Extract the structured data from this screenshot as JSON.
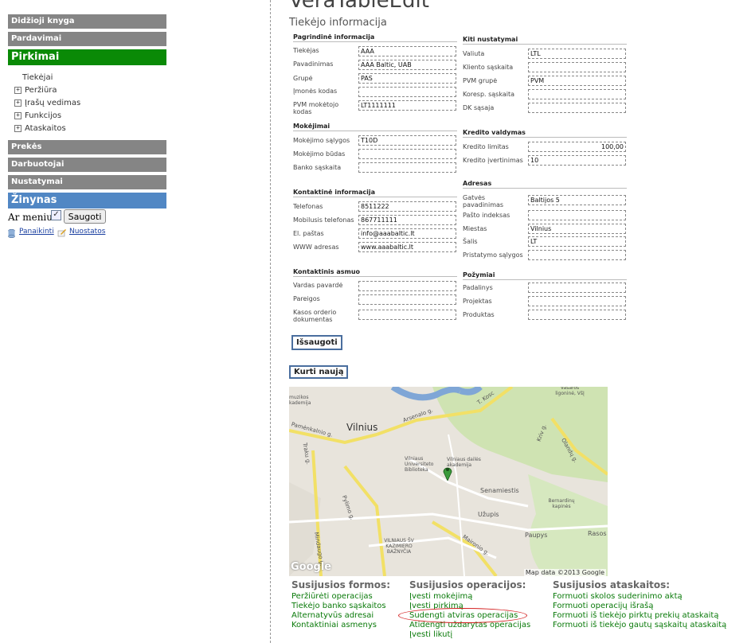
{
  "page": {
    "title_partial": "VeraTableEdit",
    "section_title": "Tiekėjo informacija"
  },
  "sidebar": {
    "menu": [
      {
        "label": "Didžioji knyga"
      },
      {
        "label": "Pardavimai"
      },
      {
        "label": "Pirkimai"
      },
      {
        "label": "Prekės"
      },
      {
        "label": "Darbuotojai"
      },
      {
        "label": "Nustatymai"
      },
      {
        "label": "Žinynas"
      }
    ],
    "sub": [
      {
        "label": "Tiekėjai"
      },
      {
        "label": "Peržiūra"
      },
      {
        "label": "Įrašų vedimas"
      },
      {
        "label": "Funkcijos"
      },
      {
        "label": "Ataskaitos"
      }
    ],
    "armenu_label": "Ar meniu:",
    "save_label": "Saugoti",
    "clear_label": "Panaikinti",
    "settings_label": "Nuostatos"
  },
  "form": {
    "main_info": {
      "title": "Pagrindinė informacija",
      "fields": [
        {
          "label": "Tiekėjas",
          "value": "AAA"
        },
        {
          "label": "Pavadinimas",
          "value": "AAA Baltic, UAB"
        },
        {
          "label": "Grupė",
          "value": "PAS"
        },
        {
          "label": "Įmonės kodas",
          "value": ""
        },
        {
          "label": "PVM mokėtojo kodas",
          "value": "LT1111111"
        }
      ]
    },
    "other_settings": {
      "title": "Kiti nustatymai",
      "fields": [
        {
          "label": "Valiuta",
          "value": "LTL"
        },
        {
          "label": "Kliento sąskaita",
          "value": ""
        },
        {
          "label": "PVM grupė",
          "value": "PVM"
        },
        {
          "label": "Koresp. sąskaita",
          "value": ""
        },
        {
          "label": "DK sąsaja",
          "value": ""
        }
      ]
    },
    "payments": {
      "title": "Mokėjimai",
      "fields": [
        {
          "label": "Mokėjimo sąlygos",
          "value": "T10D"
        },
        {
          "label": "Mokėjimo būdas",
          "value": ""
        },
        {
          "label": "Banko sąskaita",
          "value": ""
        }
      ]
    },
    "credit": {
      "title": "Kredito valdymas",
      "fields": [
        {
          "label": "Kredito limitas",
          "value": "100,00"
        },
        {
          "label": "Kredito įvertinimas",
          "value": "10"
        }
      ]
    },
    "contacts": {
      "title": "Kontaktinė informacija",
      "fields": [
        {
          "label": "Telefonas",
          "value": "8511222"
        },
        {
          "label": "Mobilusis telefonas",
          "value": "867711111"
        },
        {
          "label": "El. paštas",
          "value": "info@aaabaltic.lt"
        },
        {
          "label": "WWW adresas",
          "value": "www.aaabaltic.lt"
        }
      ]
    },
    "address": {
      "title": "Adresas",
      "fields": [
        {
          "label": "Gatvės pavadinimas",
          "value": "Baltijos 5"
        },
        {
          "label": "Pašto indeksas",
          "value": ""
        },
        {
          "label": "Miestas",
          "value": "Vilnius"
        },
        {
          "label": "Šalis",
          "value": "LT"
        },
        {
          "label": "Pristatymo sąlygos",
          "value": ""
        }
      ]
    },
    "contact_person": {
      "title": "Kontaktinis asmuo",
      "fields": [
        {
          "label": "Vardas pavardė",
          "value": ""
        },
        {
          "label": "Pareigos",
          "value": ""
        },
        {
          "label": "Kasos orderio dokumentas",
          "value": ""
        }
      ]
    },
    "features": {
      "title": "Požymiai",
      "fields": [
        {
          "label": "Padalinys",
          "value": ""
        },
        {
          "label": "Projektas",
          "value": ""
        },
        {
          "label": "Produktas",
          "value": ""
        }
      ]
    },
    "save_button": "Išsaugoti",
    "new_button": "Kurti naują"
  },
  "map": {
    "labels": [
      "Vilnius",
      "Vilniaus Universiteto Biblioteka",
      "Vilniaus dailės akademija",
      "Senamiestis",
      "Užupis",
      "Paupys",
      "Rasos",
      "VILNIAUS ŠV KAZIMIERO BAŽNYČIA",
      "Bernardinų kapinės",
      "Vasaros ligoninė, VšĮ",
      "muzikos kademija",
      "Arsenalo g.",
      "T. Kosc",
      "Pamėnkalnio g.",
      "Traku g.",
      "Pylimo g.",
      "Mindaugo g.",
      "Maironio g.",
      "Olandų g.",
      "Kriv g."
    ],
    "google": "Google",
    "credit": "Map data ©2013 Google"
  },
  "related": {
    "forms_title": "Susijusios formos:",
    "forms": [
      "Peržiūrėti operacijas",
      "Tiekėjo banko sąskaitos",
      "Alternatyvūs adresai",
      "Kontaktiniai asmenys"
    ],
    "ops_title": "Susijusios operacijos:",
    "ops": [
      "Įvesti mokėjimą",
      "Įvesti pirkimą",
      "Sudengti atviras operacijas",
      "Atidengti uždarytas operacijas",
      "Įvesti likutį"
    ],
    "reports_title": "Susijusios ataskaitos:",
    "reports": [
      "Formuoti skolos suderinimo aktą",
      "Formuoti operacijų išrašą",
      "Formuoti iš tiekėjo pirktų prekių ataskaitą",
      "Formuoti iš tiekėjo gautų sąskaitų ataskaitą"
    ]
  }
}
